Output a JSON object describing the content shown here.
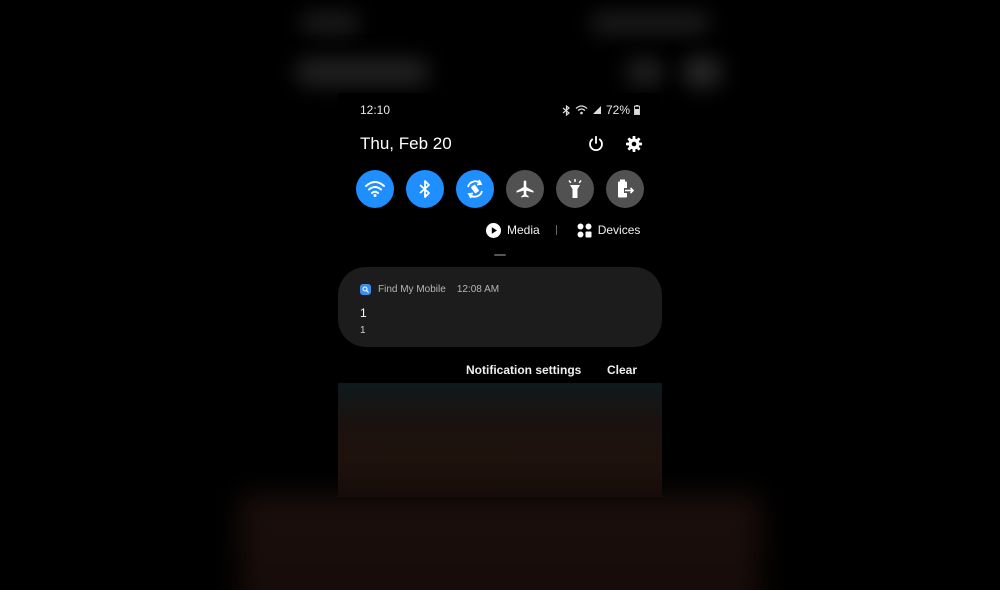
{
  "status_bar": {
    "time": "12:10",
    "battery": "72%",
    "icons": [
      "bluetooth-icon",
      "wifi-icon",
      "signal-icon",
      "battery-icon"
    ]
  },
  "header": {
    "date": "Thu, Feb 20",
    "icons": [
      "power-icon",
      "settings-gear-icon"
    ]
  },
  "quick_settings": {
    "tiles": [
      {
        "icon": "wifi-icon",
        "state": "on"
      },
      {
        "icon": "bluetooth-icon",
        "state": "on"
      },
      {
        "icon": "auto-rotate-icon",
        "state": "on"
      },
      {
        "icon": "airplane-icon",
        "state": "off"
      },
      {
        "icon": "flashlight-icon",
        "state": "off"
      },
      {
        "icon": "power-saving-icon",
        "state": "off"
      }
    ]
  },
  "media_row": {
    "media_label": "Media",
    "devices_label": "Devices"
  },
  "notification": {
    "app_name": "Find My Mobile",
    "time": "12:08 AM",
    "title": "1",
    "text": "1"
  },
  "actions": {
    "settings_label": "Notification settings",
    "clear_label": "Clear"
  },
  "colors": {
    "accent": "#1f8fff",
    "tile_off": "#515151",
    "card": "#1c1c1c"
  }
}
